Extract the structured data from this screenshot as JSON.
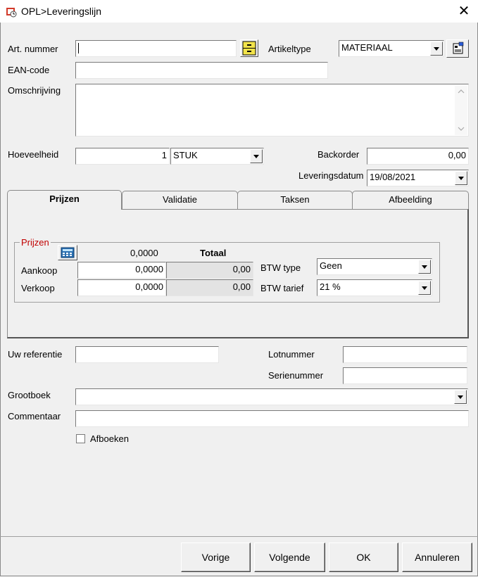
{
  "window": {
    "title": "OPL>Leveringslijn",
    "close_icon": "close-icon"
  },
  "fields": {
    "art_nummer": {
      "label": "Art. nummer",
      "value": ""
    },
    "artikeltype": {
      "label": "Artikeltype",
      "value": "MATERIAAL"
    },
    "ean_code": {
      "label": "EAN-code",
      "value": ""
    },
    "omschrijving": {
      "label": "Omschrijving",
      "value": ""
    },
    "hoeveelheid": {
      "label": "Hoeveelheid",
      "value": "1",
      "unit": "STUK"
    },
    "backorder": {
      "label": "Backorder",
      "value": "0,00"
    },
    "leveringsdatum": {
      "label": "Leveringsdatum",
      "value": "19/08/2021"
    }
  },
  "tabs": [
    {
      "label": "Prijzen",
      "active": true
    },
    {
      "label": "Validatie",
      "active": false
    },
    {
      "label": "Taksen",
      "active": false
    },
    {
      "label": "Afbeelding",
      "active": false
    }
  ],
  "prijzen": {
    "group_title": "Prijzen",
    "header_value": "0,0000",
    "header_totaal": "Totaal",
    "aankoop": {
      "label": "Aankoop",
      "value": "0,0000",
      "totaal": "0,00"
    },
    "verkoop": {
      "label": "Verkoop",
      "value": "0,0000",
      "totaal": "0,00"
    },
    "btw_type": {
      "label": "BTW type",
      "value": "Geen"
    },
    "btw_tarief": {
      "label": "BTW tarief",
      "value": "21 %"
    }
  },
  "lower": {
    "uw_referentie": {
      "label": "Uw referentie",
      "value": ""
    },
    "lotnummer": {
      "label": "Lotnummer",
      "value": ""
    },
    "serienummer": {
      "label": "Serienummer",
      "value": ""
    },
    "grootboek": {
      "label": "Grootboek",
      "value": ""
    },
    "commentaar": {
      "label": "Commentaar",
      "value": ""
    },
    "afboeken": {
      "label": "Afboeken",
      "checked": false
    }
  },
  "buttons": {
    "vorige": "Vorige",
    "volgende": "Volgende",
    "ok": "OK",
    "annuleren": "Annuleren"
  },
  "colors": {
    "group_title": "#c00000",
    "window_bg": "#f0f0f0"
  }
}
